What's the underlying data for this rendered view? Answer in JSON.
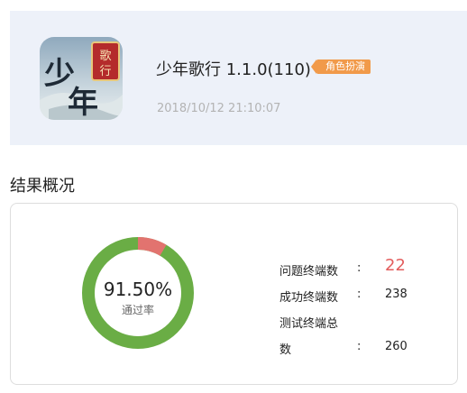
{
  "app": {
    "name": "少年歌行 1.1.0(110)",
    "genre": "角色扮演",
    "timestamp": "2018/10/12 21:10:07",
    "icon_name": "app-icon-shaonian-gexing",
    "icon_text_main": "少年",
    "icon_text_tag": "歌行"
  },
  "section": {
    "title": "结果概况"
  },
  "summary": {
    "pass_rate_text": "91.50%",
    "pass_rate_label": "通过率",
    "pass_fraction": 0.915,
    "stats": [
      {
        "label": "问题终端数",
        "value": "22",
        "status": "alert"
      },
      {
        "label": "成功终端数",
        "value": "238"
      },
      {
        "label_line1": "测试终端总",
        "label_line2": "数",
        "value": "260"
      }
    ],
    "colors": {
      "pass": "#6aad45",
      "fail": "#e2736f",
      "alert_text": "#e35d5d",
      "badge": "#f19a4a"
    }
  }
}
